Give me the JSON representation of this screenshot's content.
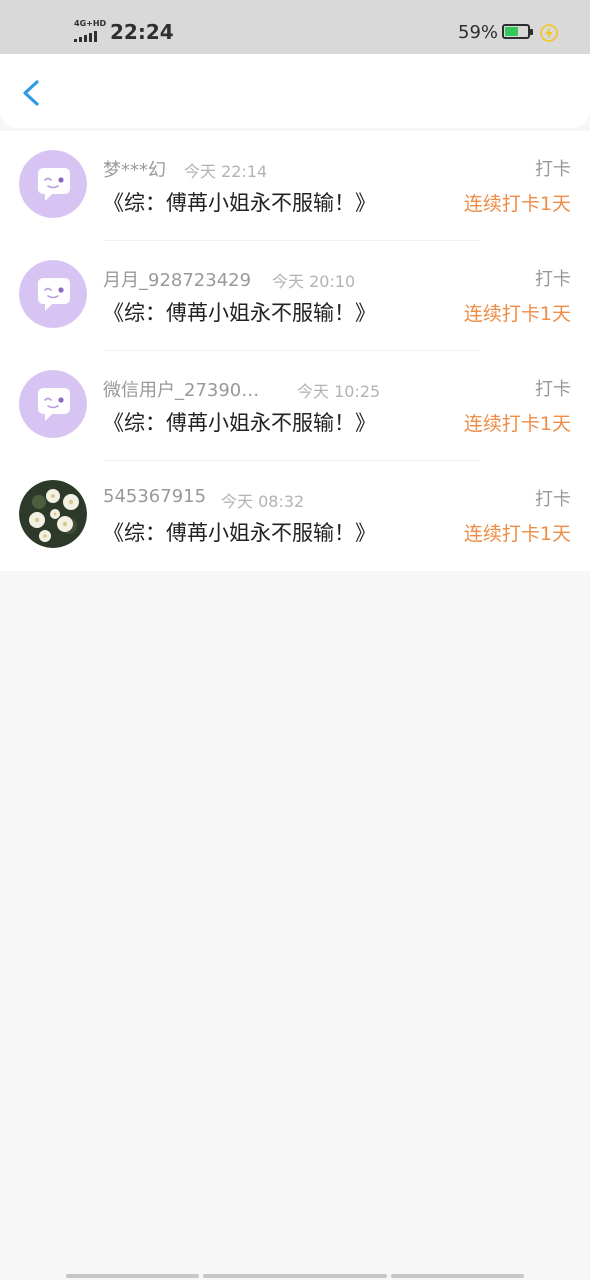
{
  "status_bar": {
    "network": "4G+HD",
    "time": "22:24",
    "battery_percent": "59%",
    "battery_level": 0.59,
    "battery_color": "#34c759",
    "charging_icon": "bolt-icon"
  },
  "nav": {
    "back_icon": "chevron-left-icon",
    "accent": "#2b9be6"
  },
  "colors": {
    "streak": "#ef8c46",
    "avatar_bg": "#d8c4f2"
  },
  "items": [
    {
      "name": "梦***幻",
      "date": "今天 22:14",
      "book": "《综：傅苒小姐永不服输！》",
      "action": "打卡",
      "streak": "连续打卡1天",
      "avatar": "chat-bubble-avatar"
    },
    {
      "name": "月月_928723429",
      "date": "今天 20:10",
      "book": "《综：傅苒小姐永不服输！》",
      "action": "打卡",
      "streak": "连续打卡1天",
      "avatar": "chat-bubble-avatar"
    },
    {
      "name": "微信用户_27390…",
      "date": "今天 10:25",
      "book": "《综：傅苒小姐永不服输！》",
      "action": "打卡",
      "streak": "连续打卡1天",
      "avatar": "chat-bubble-avatar"
    },
    {
      "name": "545367915",
      "date": "今天 08:32",
      "book": "《综：傅苒小姐永不服输！》",
      "action": "打卡",
      "streak": "连续打卡1天",
      "avatar": "flower-photo-avatar"
    }
  ]
}
